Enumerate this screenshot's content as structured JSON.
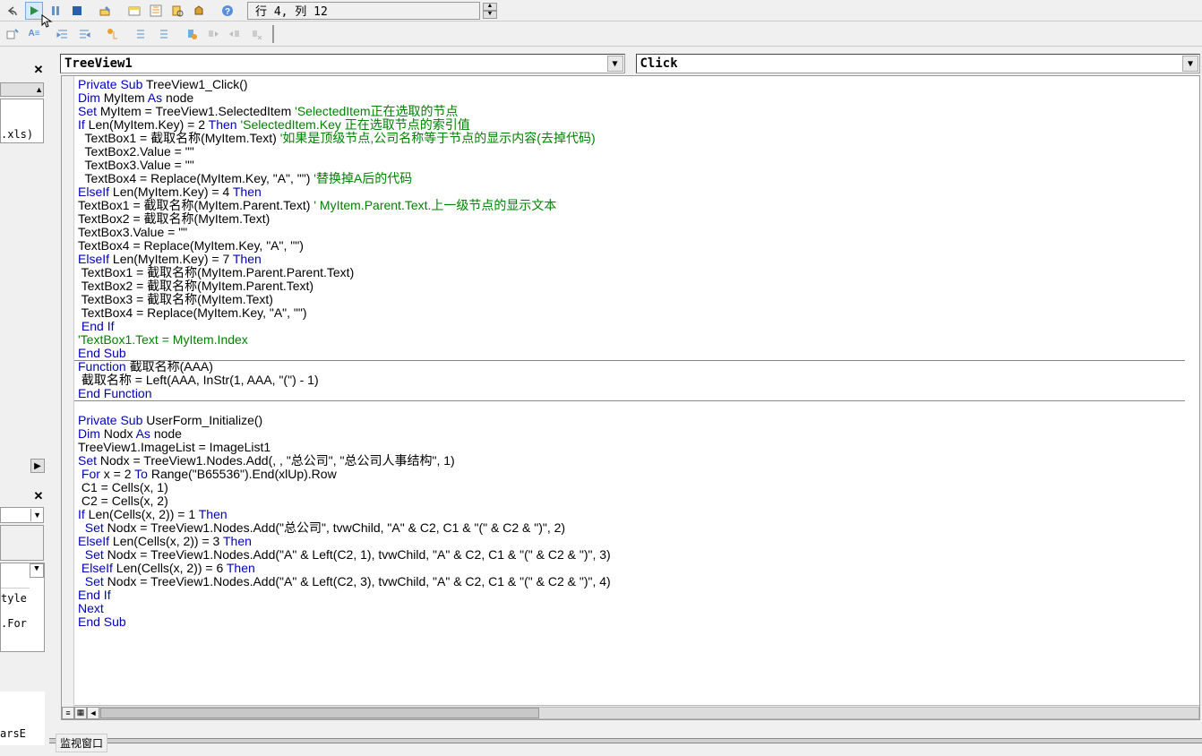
{
  "toolbar1": {
    "line_col_text": "行 4, 列 12"
  },
  "dropdowns": {
    "object": "TreeView1",
    "procedure": "Click"
  },
  "left_fragments": {
    "xls": ".xls)",
    "tyle": "tyle",
    "for": ".For",
    "arse": "arsE"
  },
  "status": {
    "watch_window": "监视窗口"
  },
  "code": {
    "lines": [
      {
        "seg": [
          {
            "t": "Private Sub",
            "c": "kw"
          },
          {
            "t": " TreeView1_Click()"
          }
        ]
      },
      {
        "seg": [
          {
            "t": "Dim",
            "c": "kw"
          },
          {
            "t": " MyItem "
          },
          {
            "t": "As",
            "c": "kw"
          },
          {
            "t": " node"
          }
        ]
      },
      {
        "seg": [
          {
            "t": "Set",
            "c": "kw"
          },
          {
            "t": " MyItem = TreeView1.SelectedItem "
          },
          {
            "t": "'SelectedItem正在选取的节点",
            "c": "cm"
          }
        ]
      },
      {
        "seg": [
          {
            "t": "If",
            "c": "kw"
          },
          {
            "t": " Len(MyItem.Key) = 2 "
          },
          {
            "t": "Then",
            "c": "kw"
          },
          {
            "t": " "
          },
          {
            "t": "'SelectedItem.Key 正在选取节点的索引值",
            "c": "cm"
          }
        ]
      },
      {
        "seg": [
          {
            "t": "  TextBox1 = 截取名称(MyItem.Text) "
          },
          {
            "t": "'如果是顶级节点,公司名称等于节点的显示内容(去掉代码)",
            "c": "cm"
          }
        ]
      },
      {
        "seg": [
          {
            "t": "  TextBox2.Value = \"\""
          }
        ]
      },
      {
        "seg": [
          {
            "t": "  TextBox3.Value = \"\""
          }
        ]
      },
      {
        "seg": [
          {
            "t": "  TextBox4 = Replace(MyItem.Key, \"A\", \"\") "
          },
          {
            "t": "'替换掉A后的代码",
            "c": "cm"
          }
        ]
      },
      {
        "seg": [
          {
            "t": "ElseIf",
            "c": "kw"
          },
          {
            "t": " Len(MyItem.Key) = 4 "
          },
          {
            "t": "Then",
            "c": "kw"
          }
        ]
      },
      {
        "seg": [
          {
            "t": "TextBox1 = 截取名称(MyItem.Parent.Text) "
          },
          {
            "t": "' MyItem.Parent.Text.上一级节点的显示文本",
            "c": "cm"
          }
        ]
      },
      {
        "seg": [
          {
            "t": "TextBox2 = 截取名称(MyItem.Text)"
          }
        ]
      },
      {
        "seg": [
          {
            "t": "TextBox3.Value = \"\""
          }
        ]
      },
      {
        "seg": [
          {
            "t": "TextBox4 = Replace(MyItem.Key, \"A\", \"\")"
          }
        ]
      },
      {
        "seg": [
          {
            "t": "ElseIf",
            "c": "kw"
          },
          {
            "t": " Len(MyItem.Key) = 7 "
          },
          {
            "t": "Then",
            "c": "kw"
          }
        ]
      },
      {
        "seg": [
          {
            "t": " TextBox1 = 截取名称(MyItem.Parent.Parent.Text)"
          }
        ]
      },
      {
        "seg": [
          {
            "t": " TextBox2 = 截取名称(MyItem.Parent.Text)"
          }
        ]
      },
      {
        "seg": [
          {
            "t": " TextBox3 = 截取名称(MyItem.Text)"
          }
        ]
      },
      {
        "seg": [
          {
            "t": " TextBox4 = Replace(MyItem.Key, \"A\", \"\")"
          }
        ]
      },
      {
        "seg": [
          {
            "t": " End If",
            "c": "kw"
          }
        ]
      },
      {
        "seg": [
          {
            "t": "'TextBox1.Text = MyItem.Index",
            "c": "cm"
          }
        ]
      },
      {
        "seg": [
          {
            "t": "End Sub",
            "c": "kw"
          }
        ]
      },
      {
        "sep": true
      },
      {
        "seg": [
          {
            "t": "Function",
            "c": "kw"
          },
          {
            "t": " 截取名称(AAA)"
          }
        ]
      },
      {
        "seg": [
          {
            "t": " 截取名称 = Left(AAA, InStr(1, AAA, \"(\") - 1)"
          }
        ]
      },
      {
        "seg": [
          {
            "t": "End Function",
            "c": "kw"
          }
        ]
      },
      {
        "sep": true
      },
      {
        "seg": [
          {
            "t": ""
          }
        ]
      },
      {
        "seg": [
          {
            "t": "Private Sub",
            "c": "kw"
          },
          {
            "t": " UserForm_Initialize()"
          }
        ]
      },
      {
        "seg": [
          {
            "t": "Dim",
            "c": "kw"
          },
          {
            "t": " Nodx "
          },
          {
            "t": "As",
            "c": "kw"
          },
          {
            "t": " node"
          }
        ]
      },
      {
        "seg": [
          {
            "t": "TreeView1.ImageList = ImageList1"
          }
        ]
      },
      {
        "seg": [
          {
            "t": "Set",
            "c": "kw"
          },
          {
            "t": " Nodx = TreeView1.Nodes.Add(, , \"总公司\", \"总公司人事结构\", 1)"
          }
        ]
      },
      {
        "seg": [
          {
            "t": " For",
            "c": "kw"
          },
          {
            "t": " x = 2 "
          },
          {
            "t": "To",
            "c": "kw"
          },
          {
            "t": " Range(\"B65536\").End(xlUp).Row"
          }
        ]
      },
      {
        "seg": [
          {
            "t": " C1 = Cells(x, 1)"
          }
        ]
      },
      {
        "seg": [
          {
            "t": " C2 = Cells(x, 2)"
          }
        ]
      },
      {
        "seg": [
          {
            "t": "If",
            "c": "kw"
          },
          {
            "t": " Len(Cells(x, 2)) = 1 "
          },
          {
            "t": "Then",
            "c": "kw"
          }
        ]
      },
      {
        "seg": [
          {
            "t": "  Set",
            "c": "kw"
          },
          {
            "t": " Nodx = TreeView1.Nodes.Add(\"总公司\", tvwChild, \"A\" & C2, C1 & \"(\" & C2 & \")\", 2)"
          }
        ]
      },
      {
        "seg": [
          {
            "t": "ElseIf",
            "c": "kw"
          },
          {
            "t": " Len(Cells(x, 2)) = 3 "
          },
          {
            "t": "Then",
            "c": "kw"
          }
        ]
      },
      {
        "seg": [
          {
            "t": "  Set",
            "c": "kw"
          },
          {
            "t": " Nodx = TreeView1.Nodes.Add(\"A\" & Left(C2, 1), tvwChild, \"A\" & C2, C1 & \"(\" & C2 & \")\", 3)"
          }
        ]
      },
      {
        "seg": [
          {
            "t": " ElseIf",
            "c": "kw"
          },
          {
            "t": " Len(Cells(x, 2)) = 6 "
          },
          {
            "t": "Then",
            "c": "kw"
          }
        ]
      },
      {
        "seg": [
          {
            "t": "  Set",
            "c": "kw"
          },
          {
            "t": " Nodx = TreeView1.Nodes.Add(\"A\" & Left(C2, 3), tvwChild, \"A\" & C2, C1 & \"(\" & C2 & \")\", 4)"
          }
        ]
      },
      {
        "seg": [
          {
            "t": "End If",
            "c": "kw"
          }
        ]
      },
      {
        "seg": [
          {
            "t": "Next",
            "c": "kw"
          }
        ]
      },
      {
        "seg": [
          {
            "t": "End Sub",
            "c": "kw"
          }
        ]
      }
    ]
  }
}
